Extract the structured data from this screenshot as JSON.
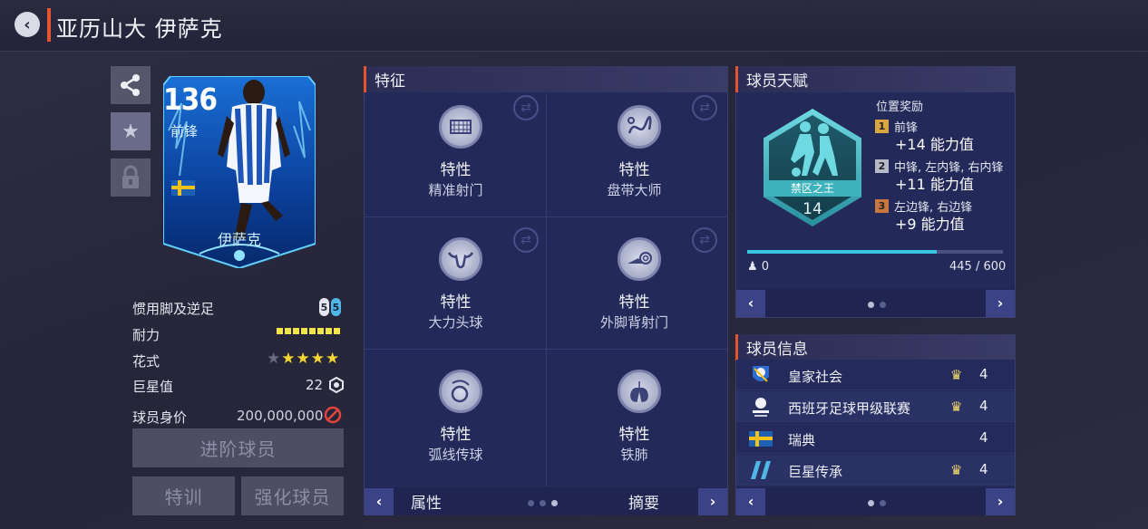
{
  "header": {
    "title": "亚历山大 伊萨克"
  },
  "card": {
    "rating": "136",
    "position": "前锋",
    "name": "伊萨克",
    "nation": "Sweden"
  },
  "stats": {
    "weak_foot_label": "惯用脚及逆足",
    "weak_foot_left": "5",
    "weak_foot_right": "5",
    "stamina_label": "耐力",
    "stamina_segments": 8,
    "skill_label": "花式",
    "skill_stars": 4,
    "skill_stars_max": 5,
    "star_value_label": "巨星值",
    "star_value": "22",
    "market_label": "球员身价",
    "market_value": "200,000,000"
  },
  "buttons": {
    "advance": "进阶球员",
    "training": "特训",
    "boost": "强化球员"
  },
  "traits_panel": {
    "title": "特征",
    "items": [
      {
        "title": "特性",
        "name": "精准射门",
        "icon": "goal-net-icon"
      },
      {
        "title": "特性",
        "name": "盘带大师",
        "icon": "dribble-path-icon"
      },
      {
        "title": "特性",
        "name": "大力头球",
        "icon": "bull-head-icon"
      },
      {
        "title": "特性",
        "name": "外脚背射门",
        "icon": "boot-swirl-icon"
      },
      {
        "title": "特性",
        "name": "弧线传球",
        "icon": "curve-ball-icon"
      },
      {
        "title": "特性",
        "name": "铁肺",
        "icon": "lungs-icon"
      }
    ],
    "footer_left": "属性",
    "footer_right": "摘要",
    "page_count": 3,
    "active_page": 3
  },
  "talent_panel": {
    "title": "球员天赋",
    "badge_name": "禁区之王",
    "badge_level": "14",
    "reward_header": "位置奖励",
    "rewards": [
      {
        "rank": "1",
        "positions": "前锋",
        "value": "+14 能力值",
        "color": "#d9a640"
      },
      {
        "rank": "2",
        "positions": "中锋, 左内锋, 右内锋",
        "value": "+11 能力值",
        "color": "#b6b9c6"
      },
      {
        "rank": "3",
        "positions": "左边锋, 右边锋",
        "value": "+9 能力值",
        "color": "#c9773f"
      }
    ],
    "progress_current": 445,
    "progress_max": 600,
    "progress_text": "445 / 600",
    "left_count": "0",
    "page_count": 2,
    "active_page": 1
  },
  "info_panel": {
    "title": "球员信息",
    "rows": [
      {
        "text": "皇家社会",
        "value": "4",
        "icon": "real-sociedad-crest-icon",
        "has_star": true
      },
      {
        "text": "西班牙足球甲级联赛",
        "value": "4",
        "icon": "laliga-logo-icon",
        "has_star": true
      },
      {
        "text": "瑞典",
        "value": "4",
        "icon": "sweden-flag-icon",
        "has_star": false
      },
      {
        "text": "巨星传承",
        "value": "4",
        "icon": "icons-logo-icon",
        "has_star": true
      }
    ],
    "page_count": 2,
    "active_page": 1
  },
  "colors": {
    "accent": "#e2552f",
    "panel": "#232a5a",
    "progress": "#36c7e0",
    "star": "#f5d534"
  }
}
